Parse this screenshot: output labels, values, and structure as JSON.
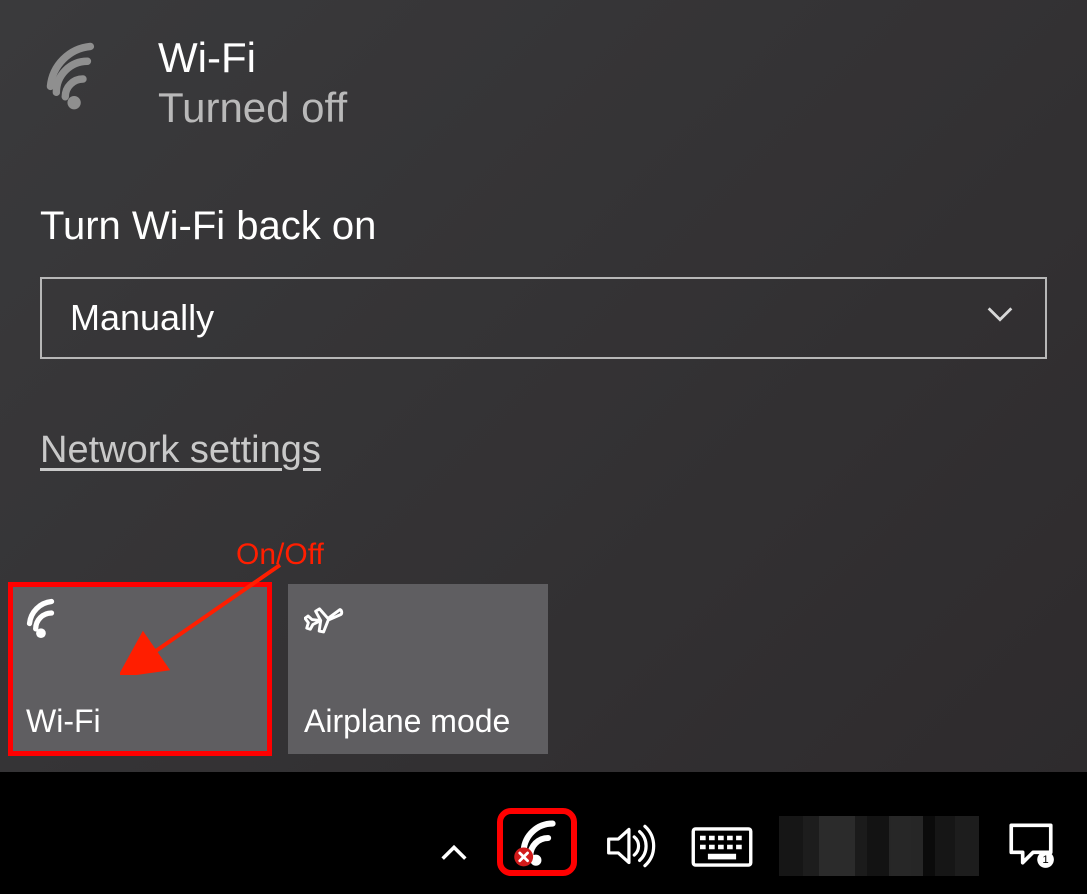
{
  "status": {
    "title": "Wi-Fi",
    "subtitle": "Turned off"
  },
  "turnBackOn": {
    "label": "Turn Wi-Fi back on",
    "selected": "Manually"
  },
  "link": {
    "networkSettings": "Network settings"
  },
  "tiles": {
    "wifi": "Wi-Fi",
    "airplane": "Airplane mode"
  },
  "annotation": {
    "onOff": "On/Off"
  }
}
